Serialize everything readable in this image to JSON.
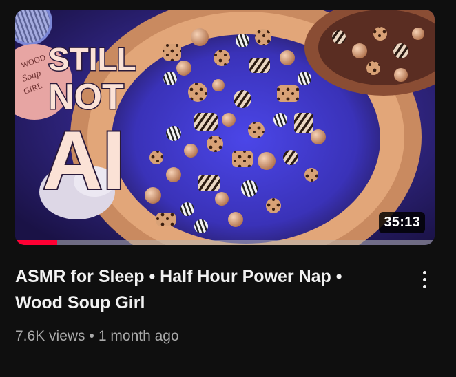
{
  "video": {
    "title": "ASMR for Sleep • Half Hour Power Nap • Wood Soup Girl",
    "views": "7.6K views",
    "separator": "•",
    "age": "1 month ago",
    "duration": "35:13",
    "watch_progress_percent": 10
  },
  "thumbnail": {
    "overlay_text": [
      "STILL",
      "NOT",
      "AI"
    ],
    "logo_text": [
      "WOOD",
      "Soup",
      "GIRL"
    ]
  },
  "icons": {
    "menu": "more-vert-icon"
  },
  "colors": {
    "background": "#0f0f0f",
    "title_text": "#f1f1f1",
    "meta_text": "#aaaaaa",
    "progress": "#ff0033"
  }
}
